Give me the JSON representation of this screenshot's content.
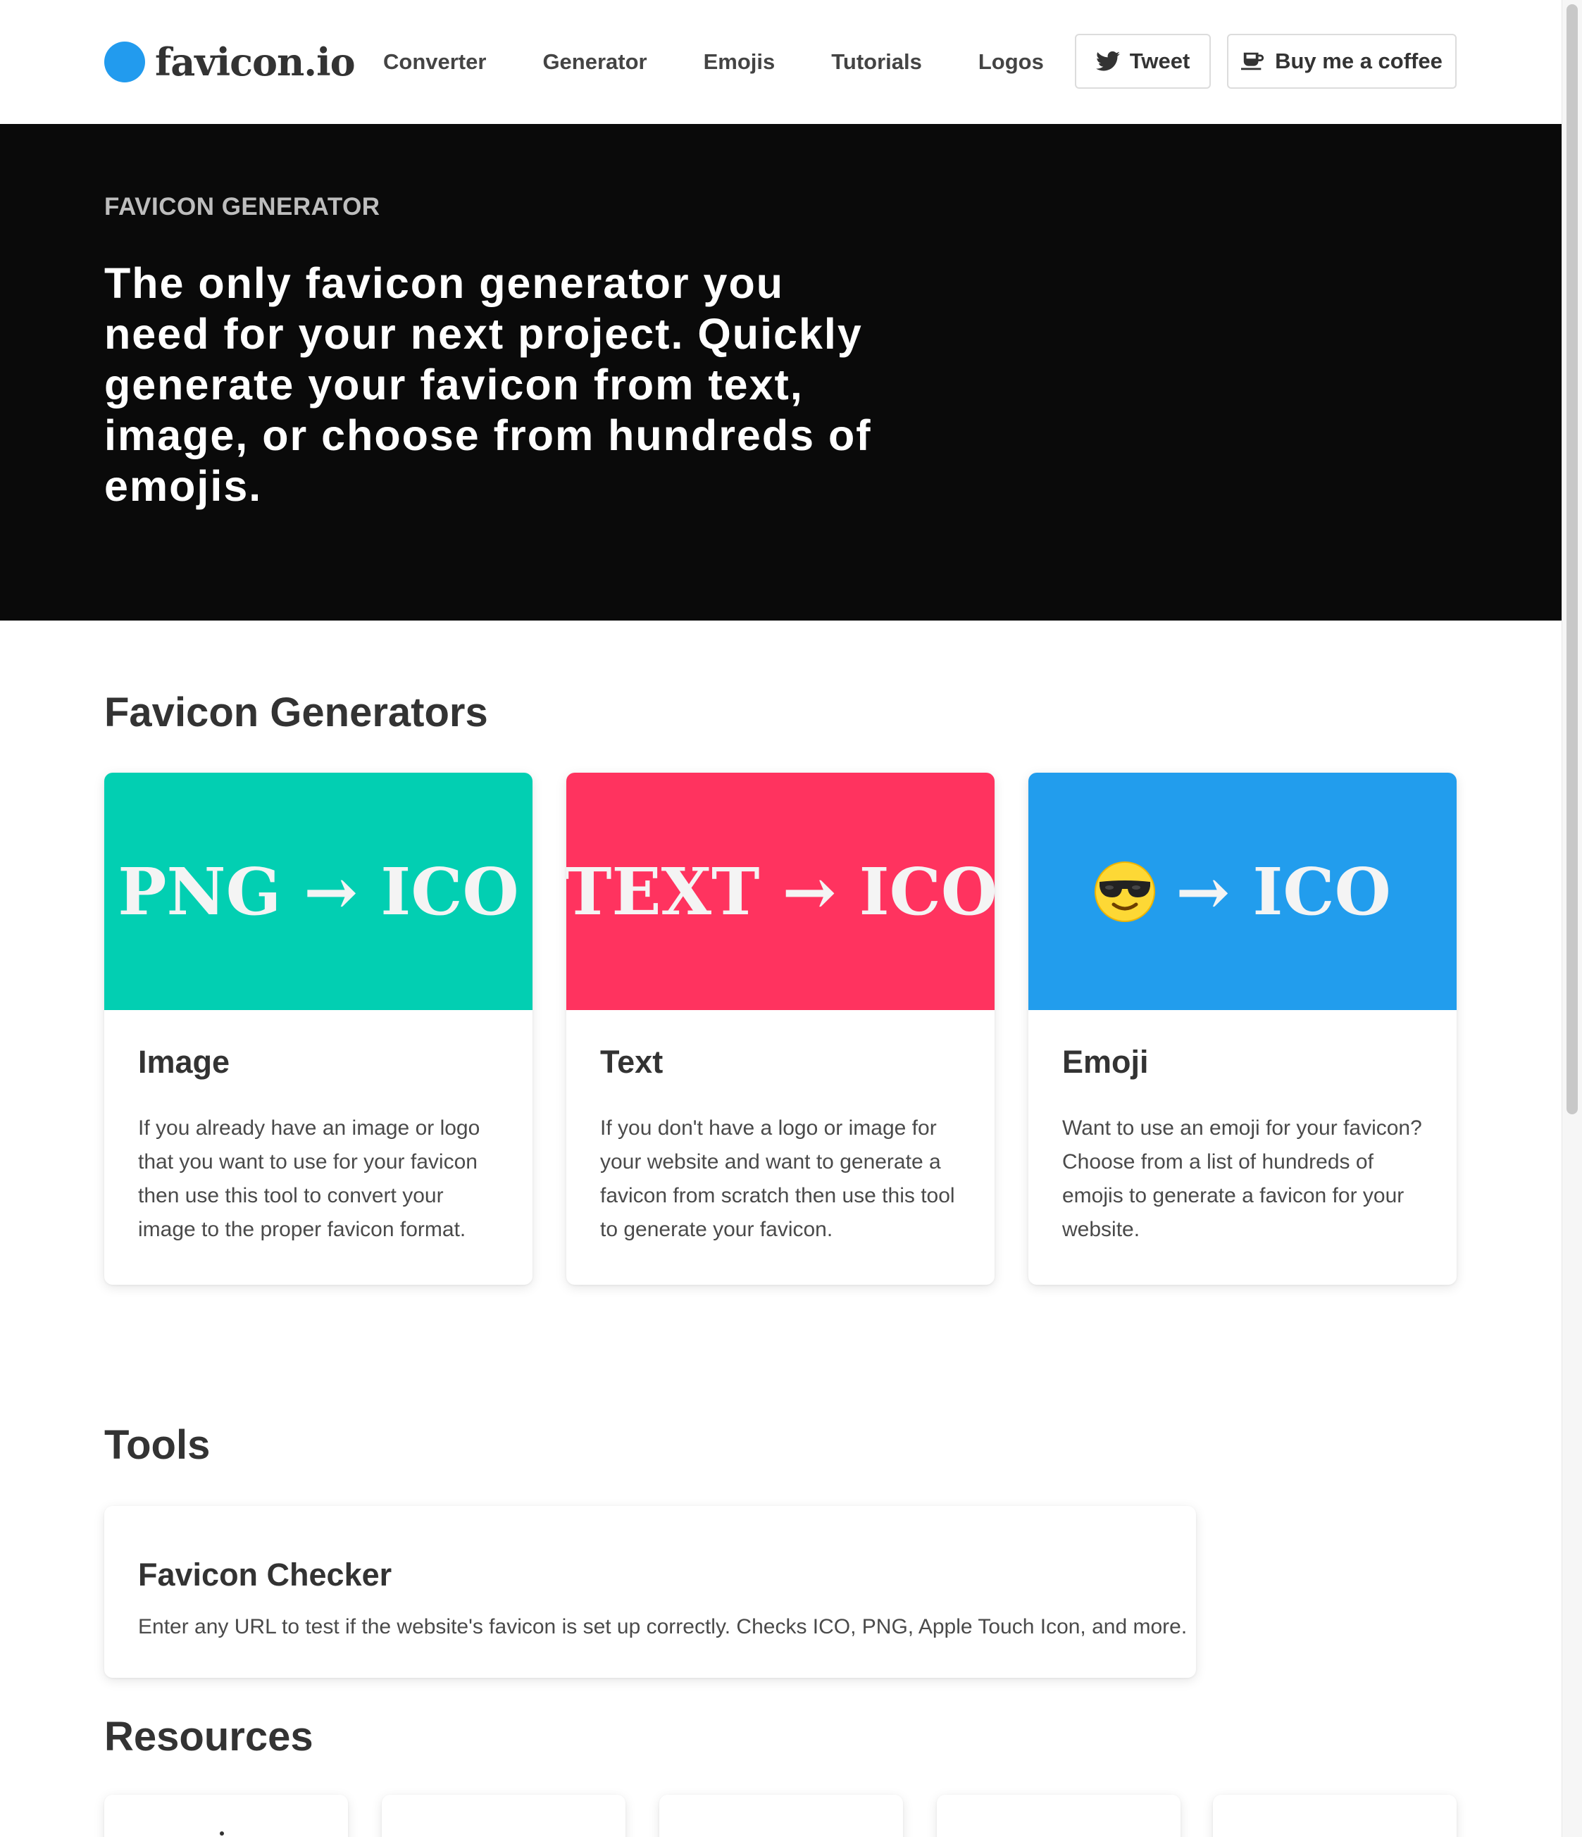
{
  "brand": {
    "name": "favicon.io",
    "color": "#229bee"
  },
  "nav": {
    "items": [
      "Converter",
      "Generator",
      "Emojis",
      "Tutorials",
      "Logos"
    ]
  },
  "header_buttons": {
    "tweet": {
      "label": "Tweet",
      "icon": "twitter-bird-icon"
    },
    "coffee": {
      "label": "Buy me a coffee",
      "icon": "coffee-cup-icon"
    }
  },
  "hero": {
    "eyebrow": "FAVICON GENERATOR",
    "title": "The only favicon generator you need for your next project. Quickly generate your favicon from text, image, or choose from hundreds of emojis."
  },
  "generators": {
    "heading": "Favicon Generators",
    "cards": [
      {
        "banner": "PNG → ICO",
        "banner_color": "#02cfb2",
        "title": "Image",
        "text": "If you already have an image or logo that you want to use for your favicon then use this tool to convert your image to the proper favicon format."
      },
      {
        "banner": "TEXT → ICO",
        "banner_color": "#ff335f",
        "title": "Text",
        "text": "If you don't have a logo or image for your website and want to generate a favicon from scratch then use this tool to generate your favicon."
      },
      {
        "banner": "→ ICO",
        "banner_emoji": "smiling-face-with-sunglasses",
        "banner_color": "#229ded",
        "title": "Emoji",
        "text": "Want to use an emoji for your favicon? Choose from a list of hundreds of emojis to generate a favicon for your website."
      }
    ]
  },
  "tools": {
    "heading": "Tools",
    "items": [
      {
        "title": "Favicon Checker",
        "text": "Enter any URL to test if the website's favicon is set up correctly. Checks ICO, PNG, Apple Touch Icon, and more."
      }
    ]
  },
  "resources": {
    "heading": "Resources"
  }
}
